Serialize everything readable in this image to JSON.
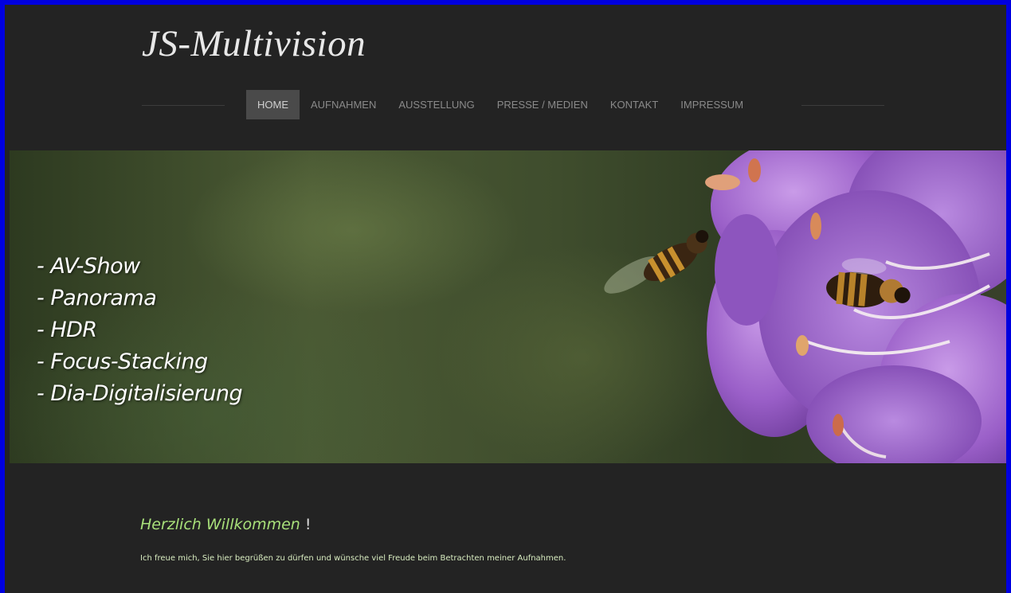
{
  "site": {
    "title": "JS-Multivision"
  },
  "nav": {
    "items": [
      {
        "label": "HOME",
        "active": true
      },
      {
        "label": "AUFNAHMEN",
        "active": false
      },
      {
        "label": "AUSSTELLUNG",
        "active": false
      },
      {
        "label": "PRESSE / MEDIEN",
        "active": false
      },
      {
        "label": "KONTAKT",
        "active": false
      },
      {
        "label": "IMPRESSUM",
        "active": false
      }
    ]
  },
  "hero": {
    "lines": [
      "- AV-Show",
      "- Panorama",
      "- HDR",
      "- Focus-Stacking",
      "- Dia-Digitalisierung"
    ],
    "image": "bees-and-purple-rhododendron"
  },
  "welcome": {
    "title": "Herzlich Willkommen",
    "title_suffix": " !",
    "text": "Ich freue mich, Sie hier begrüßen zu dürfen und wünsche viel Freude beim Betrachten meiner Aufnahmen."
  },
  "colors": {
    "page_border": "#0000e0",
    "background": "#232323",
    "accent_green": "#a8e07a",
    "nav_text": "#8a8a8a",
    "nav_active_bg": "#4a4a4a"
  }
}
